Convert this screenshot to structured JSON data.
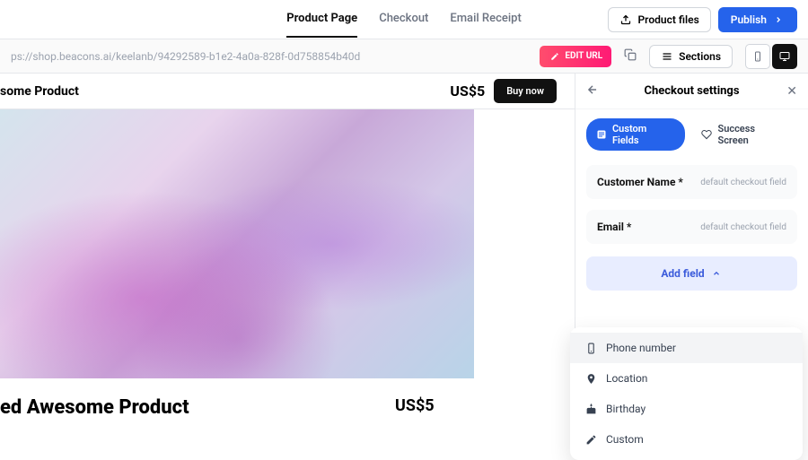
{
  "nav": {
    "tabs": [
      "Product Page",
      "Checkout",
      "Email Receipt"
    ],
    "activeIndex": 0,
    "productFiles": "Product files",
    "publish": "Publish"
  },
  "urlBar": {
    "url": "ps://shop.beacons.ai/keelanb/94292589-b1e2-4a0a-828f-0d758854b40d",
    "editUrl": "EDIT URL",
    "sections": "Sections"
  },
  "preview": {
    "titleTop": "some Product",
    "price": "US$5",
    "buyNow": "Buy now",
    "titleBig": "ed Awesome Product",
    "priceBox": "US$5"
  },
  "sidebar": {
    "title": "Checkout settings",
    "tabs": {
      "customFields": "Custom Fields",
      "successScreen": "Success Screen"
    },
    "fields": [
      {
        "label": "Customer Name *",
        "hint": "default checkout field"
      },
      {
        "label": "Email *",
        "hint": "default checkout field"
      }
    ],
    "addField": "Add field",
    "dropdown": [
      "Phone number",
      "Location",
      "Birthday",
      "Custom"
    ]
  }
}
